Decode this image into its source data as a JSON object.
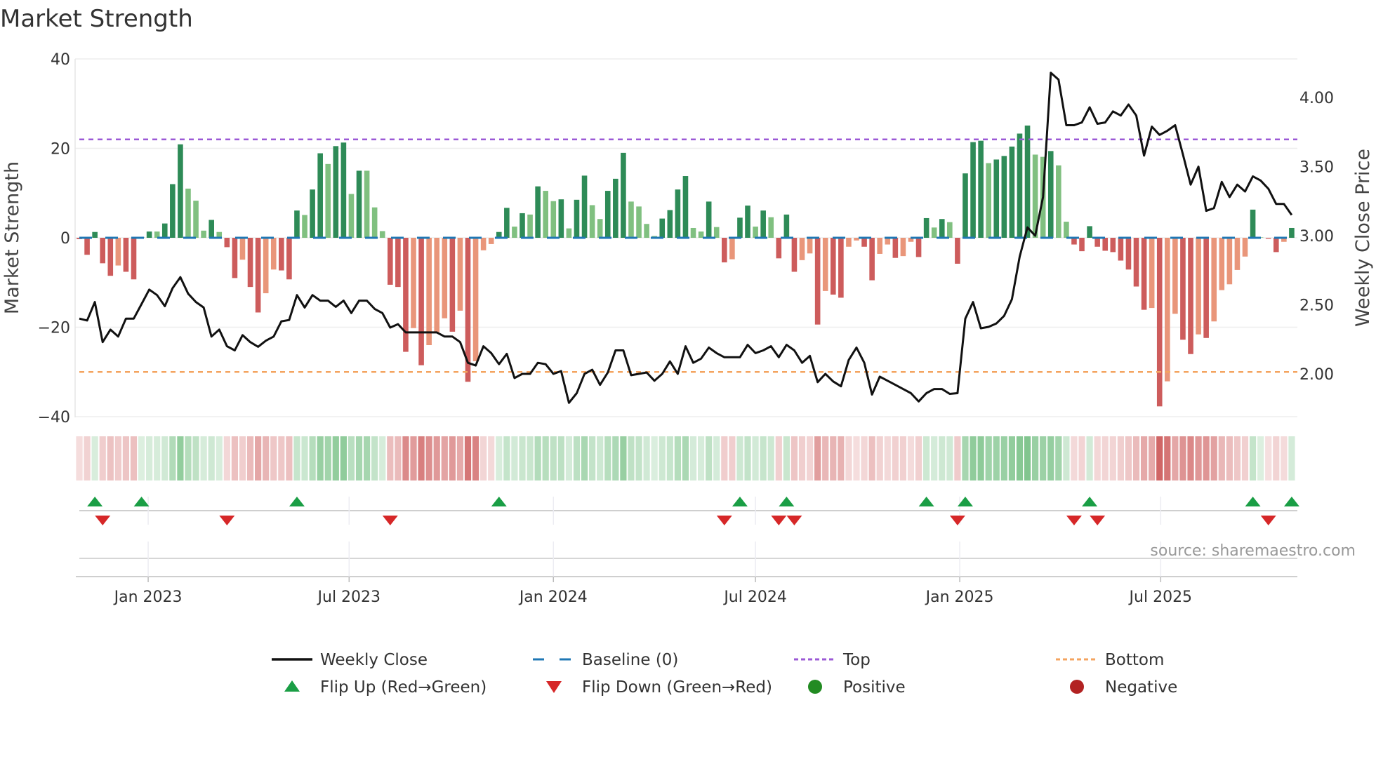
{
  "chart_data": {
    "type": "bar",
    "title": "Market Strength",
    "ylabel": "Market Strength",
    "ylabel_right": "Weekly Close Price",
    "ylim": [
      -40,
      40
    ],
    "ylim_right": [
      1.69,
      4.28
    ],
    "yticks": [
      {
        "v": 40,
        "label": "40"
      },
      {
        "v": 20,
        "label": "20"
      },
      {
        "v": 0,
        "label": "0"
      },
      {
        "v": -20,
        "label": "−20"
      },
      {
        "v": -40,
        "label": "−40"
      }
    ],
    "yticks_right": [
      {
        "v": 4.0,
        "label": "4.00"
      },
      {
        "v": 3.5,
        "label": "3.50"
      },
      {
        "v": 3.0,
        "label": "3.00"
      },
      {
        "v": 2.5,
        "label": "2.50"
      },
      {
        "v": 2.0,
        "label": "2.00"
      }
    ],
    "x_start": "2022-10-31",
    "x_step_days": 7,
    "xticks": [
      {
        "date": "2023-01-01",
        "label": "Jan 2023"
      },
      {
        "date": "2023-07-01",
        "label": "Jul 2023"
      },
      {
        "date": "2024-01-01",
        "label": "Jan 2024"
      },
      {
        "date": "2024-07-01",
        "label": "Jul 2024"
      },
      {
        "date": "2025-01-01",
        "label": "Jan 2025"
      },
      {
        "date": "2025-07-01",
        "label": "Jul 2025"
      }
    ],
    "top_level": 22,
    "bottom_level": -30,
    "baseline_level": 0,
    "strength": [
      -0.3,
      -3.8,
      1.3,
      -5.7,
      -8.5,
      -6.2,
      -7.6,
      -9.3,
      0.2,
      1.4,
      1.4,
      3.2,
      12.0,
      20.9,
      11.0,
      8.3,
      1.6,
      4.0,
      1.3,
      -2.1,
      -9.0,
      -4.9,
      -11.0,
      -16.7,
      -12.4,
      -7.1,
      -7.3,
      -9.3,
      6.1,
      5.1,
      10.8,
      18.9,
      16.5,
      20.5,
      21.3,
      9.8,
      15.0,
      15.0,
      6.8,
      1.5,
      -10.5,
      -11.0,
      -25.5,
      -20.2,
      -28.5,
      -24.0,
      -21.1,
      -18.0,
      -21.0,
      -16.3,
      -32.2,
      -27.6,
      -2.8,
      -1.4,
      1.3,
      6.7,
      2.5,
      5.5,
      5.2,
      11.5,
      10.5,
      8.2,
      8.6,
      2.1,
      8.5,
      13.9,
      7.3,
      4.2,
      10.5,
      13.2,
      19.0,
      8.1,
      7.0,
      3.1,
      0.4,
      4.3,
      6.2,
      10.8,
      13.8,
      2.2,
      1.4,
      8.1,
      2.4,
      -5.5,
      -4.8,
      4.5,
      7.2,
      2.5,
      6.1,
      4.6,
      -4.6,
      5.2,
      -7.6,
      -5.0,
      -3.5,
      -19.4,
      -11.9,
      -12.7,
      -13.4,
      -2.0,
      -0.6,
      -2.0,
      -9.5,
      -3.6,
      -1.5,
      -4.5,
      -4.1,
      -0.9,
      -4.3,
      4.4,
      2.3,
      4.2,
      3.5,
      -5.8,
      14.4,
      21.4,
      21.7,
      16.7,
      17.5,
      18.3,
      20.4,
      23.3,
      25.1,
      18.6,
      18.1,
      19.4,
      16.2,
      3.6,
      -1.5,
      -3.0,
      2.6,
      -2.0,
      -2.9,
      -3.2,
      -5.1,
      -7.1,
      -10.9,
      -16.1,
      -15.7,
      -37.7,
      -32.1,
      -17.0,
      -22.8,
      -26.0,
      -21.6,
      -22.4,
      -18.7,
      -11.7,
      -10.4,
      -7.2,
      -4.2,
      6.3,
      0.1,
      -0.2,
      -3.2,
      -0.9,
      2.2
    ],
    "weekly_close": [
      2.4,
      2.386,
      2.52,
      2.23,
      2.32,
      2.27,
      2.4,
      2.4,
      2.505,
      2.61,
      2.57,
      2.49,
      2.62,
      2.7,
      2.58,
      2.52,
      2.48,
      2.27,
      2.32,
      2.2,
      2.17,
      2.28,
      2.23,
      2.196,
      2.24,
      2.27,
      2.38,
      2.39,
      2.57,
      2.48,
      2.57,
      2.53,
      2.53,
      2.485,
      2.53,
      2.44,
      2.53,
      2.53,
      2.47,
      2.44,
      2.335,
      2.36,
      2.3,
      2.3,
      2.3,
      2.3,
      2.3,
      2.27,
      2.27,
      2.23,
      2.08,
      2.06,
      2.2,
      2.15,
      2.07,
      2.145,
      1.97,
      2.0,
      2.0,
      2.08,
      2.07,
      2.0,
      2.02,
      1.79,
      1.86,
      2.0,
      2.03,
      1.92,
      2.01,
      2.17,
      2.17,
      1.99,
      2.0,
      2.01,
      1.95,
      2.0,
      2.09,
      2.0,
      2.2,
      2.08,
      2.11,
      2.19,
      2.15,
      2.12,
      2.12,
      2.12,
      2.21,
      2.15,
      2.17,
      2.2,
      2.12,
      2.21,
      2.17,
      2.08,
      2.13,
      1.94,
      2.0,
      1.945,
      1.91,
      2.1,
      2.19,
      2.08,
      1.85,
      1.98,
      1.95,
      1.92,
      1.89,
      1.86,
      1.8,
      1.86,
      1.89,
      1.89,
      1.855,
      1.86,
      2.4,
      2.52,
      2.33,
      2.34,
      2.365,
      2.42,
      2.54,
      2.85,
      3.06,
      3.0,
      3.28,
      4.18,
      4.13,
      3.8,
      3.8,
      3.82,
      3.93,
      3.81,
      3.82,
      3.9,
      3.87,
      3.95,
      3.87,
      3.58,
      3.79,
      3.73,
      3.76,
      3.8,
      3.59,
      3.37,
      3.5,
      3.18,
      3.2,
      3.39,
      3.28,
      3.37,
      3.32,
      3.43,
      3.4,
      3.34,
      3.23,
      3.23,
      3.15
    ],
    "legend": {
      "placement": "bottom",
      "items": [
        {
          "label": "Weekly Close",
          "kind": "line"
        },
        {
          "label": "Baseline (0)",
          "kind": "dash"
        },
        {
          "label": "Top",
          "kind": "dot-top"
        },
        {
          "label": "Bottom",
          "kind": "dot-bottom"
        },
        {
          "label": "Flip Up (Red→Green)",
          "kind": "tri-up"
        },
        {
          "label": "Flip Down (Green→Red)",
          "kind": "tri-down"
        },
        {
          "label": "Positive",
          "kind": "circle-pos"
        },
        {
          "label": "Negative",
          "kind": "circle-neg"
        }
      ]
    },
    "source": "source: sharemaestro.com",
    "colors": {
      "pos_strong": "#2e8b57",
      "pos_weak": "#80c080",
      "neg_strong": "#cd5c5c",
      "neg_weak": "#e9967a",
      "price": "#111111",
      "baseline": "#1f77b4",
      "top": "#9b59d6",
      "bottom": "#f4a460",
      "flip_up": "#1a9e45",
      "flip_down": "#d62728",
      "positive": "#228b22",
      "negative": "#b22222"
    }
  }
}
